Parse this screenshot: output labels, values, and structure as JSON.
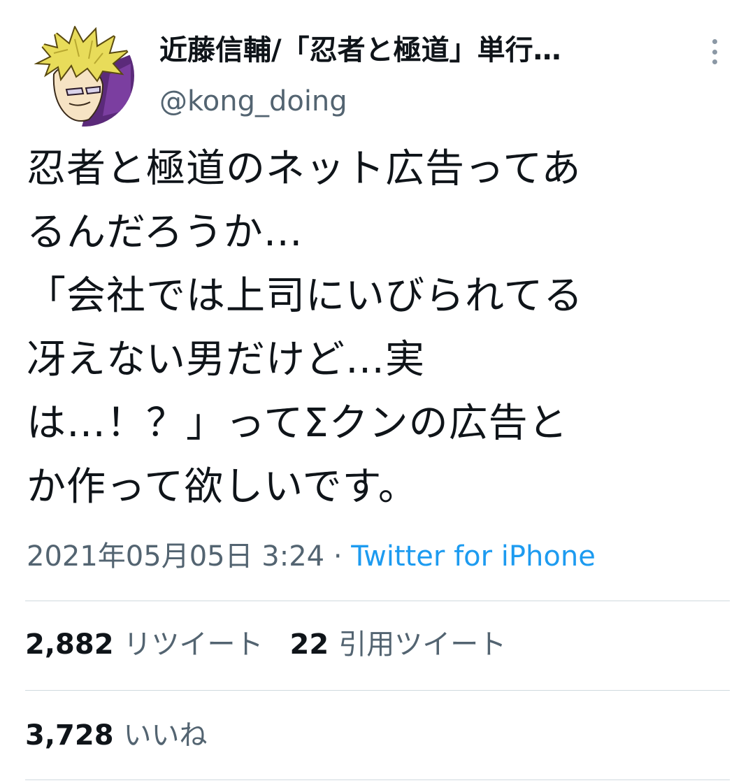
{
  "author": {
    "display_name": "近藤信輔/「忍者と極道」単行…",
    "handle": "@kong_doing",
    "avatar_icon": "avatar-illustration-blond-hair"
  },
  "more_icon": "more-options-icon",
  "tweet": {
    "text": "忍者と極道のネット広告ってあ\nるんだろうか…\n「会社では上司にいびられてる\n冴えない男だけど…実\nは…！？」ってΣクンの広告と\nか作って欲しいです。",
    "timestamp": "2021年05月05日 3:24",
    "separator": " · ",
    "source": "Twitter for iPhone"
  },
  "stats": {
    "retweets_count": "2,882",
    "retweets_label": "リツイート",
    "quotes_count": "22",
    "quotes_label": "引用ツイート",
    "likes_count": "3,728",
    "likes_label": "いいね"
  },
  "colors": {
    "text_primary": "#0f1419",
    "text_secondary": "#536471",
    "link": "#1d9bf0",
    "divider": "#cfd9de"
  }
}
